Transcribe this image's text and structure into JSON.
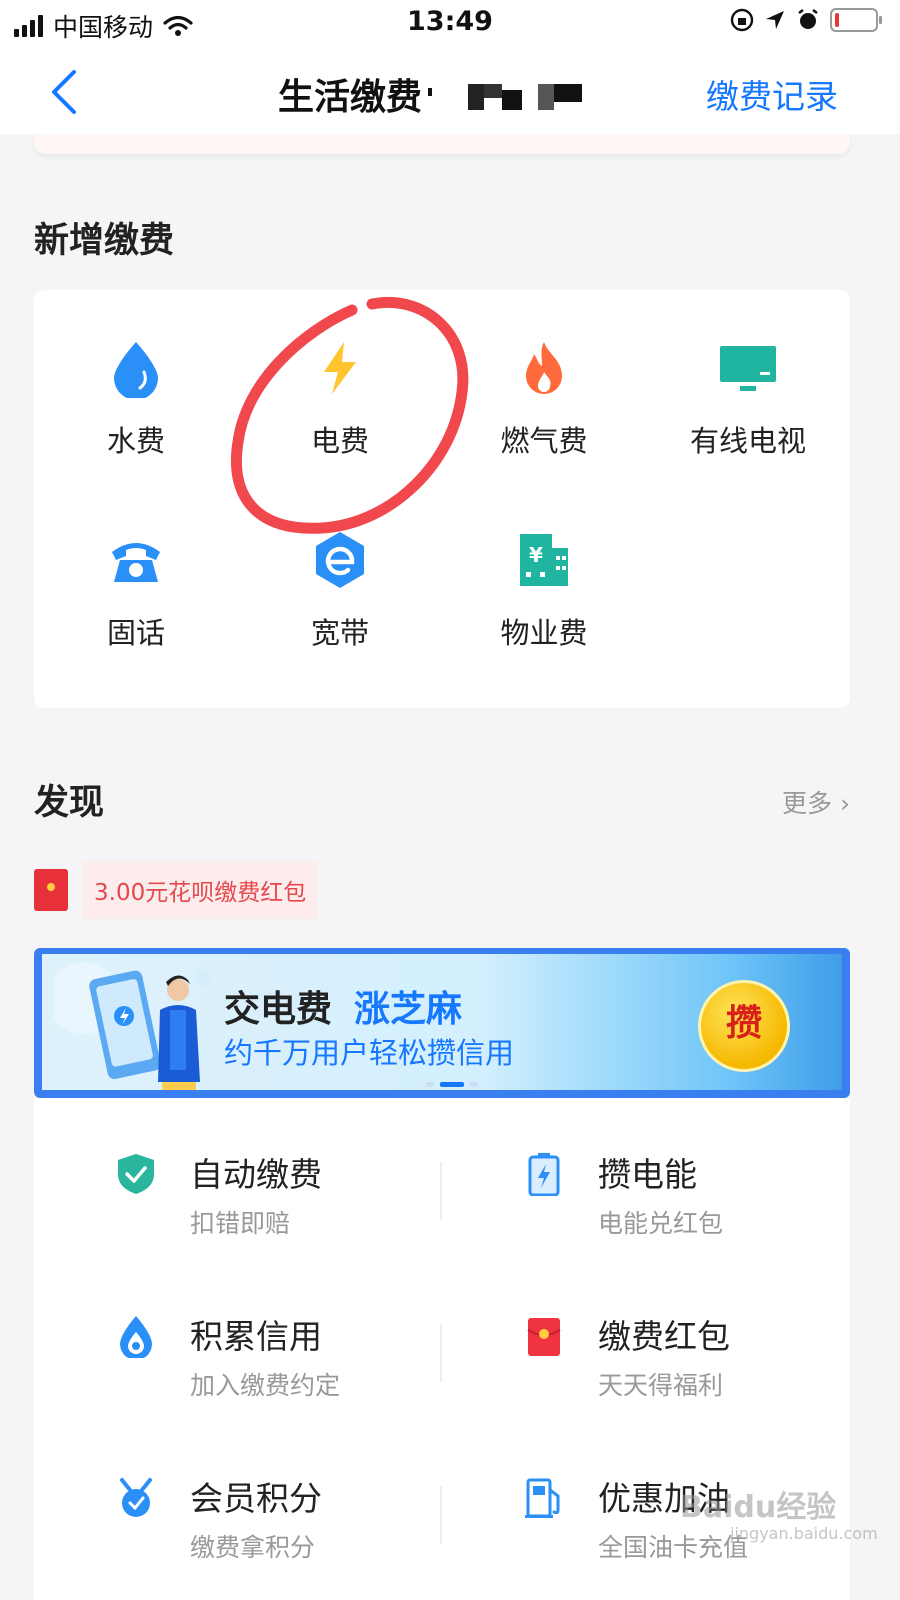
{
  "status_bar": {
    "carrier": "中国移动",
    "time": "13:49"
  },
  "nav": {
    "title": "生活缴费",
    "record_label": "缴费记录"
  },
  "new_payment": {
    "title": "新增缴费",
    "services": [
      {
        "label": "水费",
        "icon": "water-drop-icon",
        "color": "#2a8ff7"
      },
      {
        "label": "电费",
        "icon": "lightning-icon",
        "color": "#ffc42e"
      },
      {
        "label": "燃气费",
        "icon": "flame-icon",
        "color": "#ff6a3c"
      },
      {
        "label": "有线电视",
        "icon": "tv-icon",
        "color": "#1fb5a0"
      },
      {
        "label": "固话",
        "icon": "telephone-icon",
        "color": "#2a8ff7"
      },
      {
        "label": "宽带",
        "icon": "broadband-icon",
        "color": "#2a8ff7"
      },
      {
        "label": "物业费",
        "icon": "building-icon",
        "color": "#1fb5a0"
      }
    ]
  },
  "discover": {
    "title": "发现",
    "more_label": "更多",
    "hongbao_text": "3.00元花呗缴费红包",
    "banner": {
      "line1_a": "交电费",
      "line1_b": "涨芝麻",
      "line2": "约千万用户轻松攒信用",
      "badge": "攒"
    },
    "features": [
      {
        "title": "自动缴费",
        "subtitle": "扣错即赔",
        "icon": "shield-check-icon"
      },
      {
        "title": "攒电能",
        "subtitle": "电能兑红包",
        "icon": "battery-icon"
      },
      {
        "title": "积累信用",
        "subtitle": "加入缴费约定",
        "icon": "credit-drop-icon"
      },
      {
        "title": "缴费红包",
        "subtitle": "天天得福利",
        "icon": "red-envelope-icon"
      },
      {
        "title": "会员积分",
        "subtitle": "缴费拿积分",
        "icon": "member-points-icon"
      },
      {
        "title": "优惠加油",
        "subtitle": "全国油卡充值",
        "icon": "fuel-pump-icon"
      }
    ]
  },
  "watermark": {
    "brand": "Baidu经验",
    "url": "jingyan.baidu.com"
  },
  "colors": {
    "accent": "#1677ff",
    "annotation": "#f0484d"
  }
}
